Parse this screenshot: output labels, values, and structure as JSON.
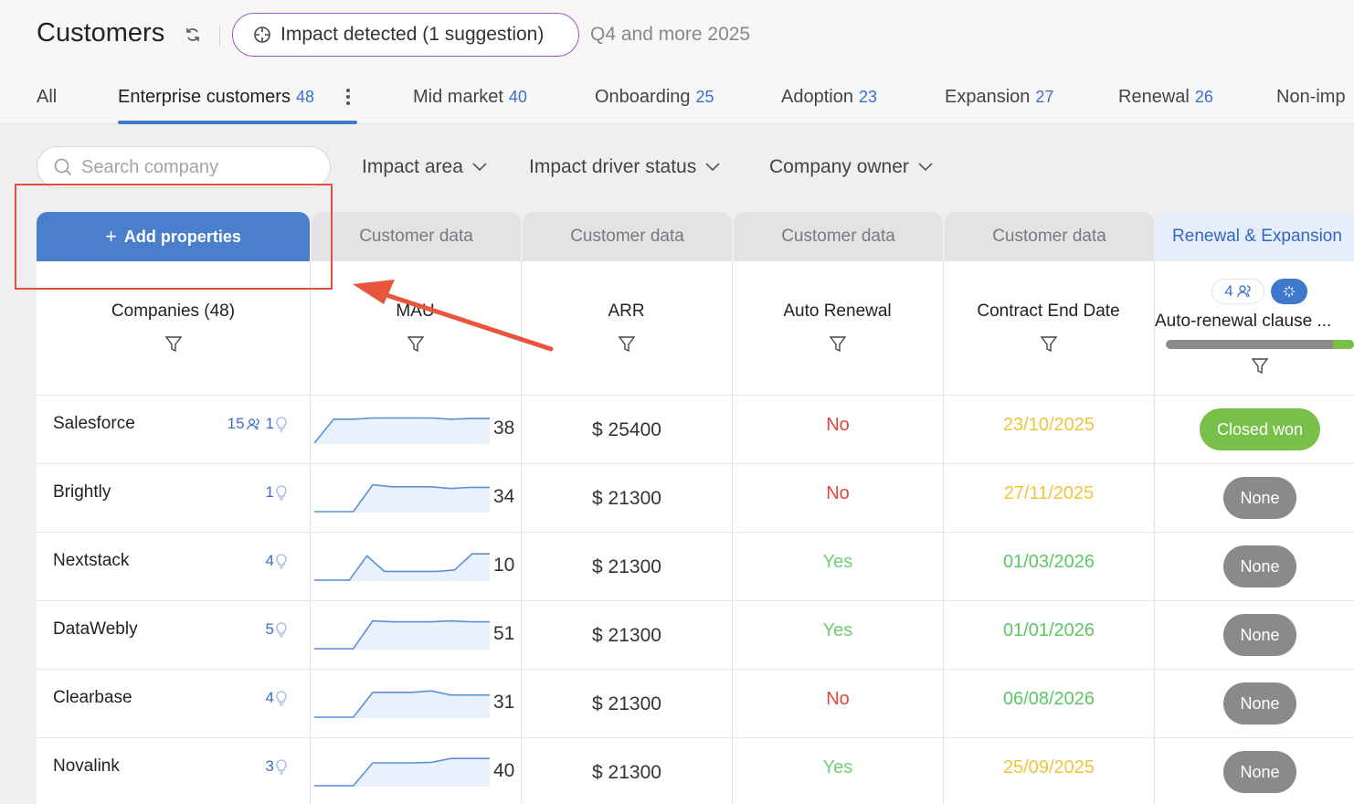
{
  "header": {
    "title": "Customers",
    "impact_label": "Impact detected (1 suggestion)",
    "period": "Q4 and more 2025"
  },
  "tabs": [
    {
      "label": "All",
      "count": ""
    },
    {
      "label": "Enterprise customers",
      "count": "48"
    },
    {
      "label": "Mid market",
      "count": "40"
    },
    {
      "label": "Onboarding",
      "count": "25"
    },
    {
      "label": "Adoption",
      "count": "23"
    },
    {
      "label": "Expansion",
      "count": "27"
    },
    {
      "label": "Renewal",
      "count": "26"
    },
    {
      "label": "Non-imp",
      "count": ""
    }
  ],
  "search": {
    "placeholder": "Search company"
  },
  "filters": [
    "Impact area",
    "Impact driver status",
    "Company owner"
  ],
  "add_properties_label": "Add properties",
  "groups": [
    "Customer data",
    "Customer data",
    "Customer data",
    "Customer data",
    "Renewal & Expansion"
  ],
  "columns": {
    "companies": "Companies (48)",
    "mau": "MAU",
    "arr": "ARR",
    "auto_renewal": "Auto Renewal",
    "contract_end": "Contract End Date",
    "clause": "Auto-renewal clause ...",
    "clause_count": "4",
    "clause_progress": 0.89
  },
  "colors": {
    "accent": "#4a7fcc",
    "yes": "#6fcf73",
    "no": "#e0463c",
    "date_yellow": "#efc53c",
    "date_green": "#5cc766",
    "closed_won": "#79c04a",
    "none": "#8a8a8d"
  },
  "rows": [
    {
      "company": "Salesforce",
      "users": "15",
      "ideas": "1",
      "mau": "38",
      "spark": [
        0,
        0.82,
        0.82,
        0.86,
        0.86,
        0.86,
        0.86,
        0.82,
        0.84,
        0.84
      ],
      "arr": "$ 25400",
      "auto_renewal": "No",
      "contract_end": "23/10/2025",
      "date_state": "yellow",
      "status": "Closed won"
    },
    {
      "company": "Brightly",
      "users": "",
      "ideas": "1",
      "mau": "34",
      "spark": [
        0,
        0,
        0,
        0.92,
        0.85,
        0.85,
        0.85,
        0.79,
        0.83,
        0.83
      ],
      "arr": "$ 21300",
      "auto_renewal": "No",
      "contract_end": "27/11/2025",
      "date_state": "yellow",
      "status": "None"
    },
    {
      "company": "Nextstack",
      "users": "",
      "ideas": "4",
      "mau": "10",
      "spark": [
        0,
        0,
        0,
        0.83,
        0.3,
        0.3,
        0.3,
        0.3,
        0.35,
        0.9,
        0.9
      ],
      "arr": "$ 21300",
      "auto_renewal": "Yes",
      "contract_end": "01/03/2026",
      "date_state": "green",
      "status": "None"
    },
    {
      "company": "DataWebly",
      "users": "",
      "ideas": "5",
      "mau": "51",
      "spark": [
        0,
        0,
        0,
        0.95,
        0.92,
        0.92,
        0.92,
        0.95,
        0.92,
        0.92
      ],
      "arr": "$ 21300",
      "auto_renewal": "Yes",
      "contract_end": "01/01/2026",
      "date_state": "green",
      "status": "None"
    },
    {
      "company": "Clearbase",
      "users": "",
      "ideas": "4",
      "mau": "31",
      "spark": [
        0,
        0,
        0,
        0.85,
        0.85,
        0.85,
        0.9,
        0.76,
        0.76,
        0.76
      ],
      "arr": "$ 21300",
      "auto_renewal": "No",
      "contract_end": "06/08/2026",
      "date_state": "green",
      "status": "None"
    },
    {
      "company": "Novalink",
      "users": "",
      "ideas": "3",
      "mau": "40",
      "spark": [
        0,
        0,
        0,
        0.78,
        0.78,
        0.78,
        0.8,
        0.93,
        0.93,
        0.93
      ],
      "arr": "$ 21300",
      "auto_renewal": "Yes",
      "contract_end": "25/09/2025",
      "date_state": "yellow",
      "status": "None"
    }
  ]
}
